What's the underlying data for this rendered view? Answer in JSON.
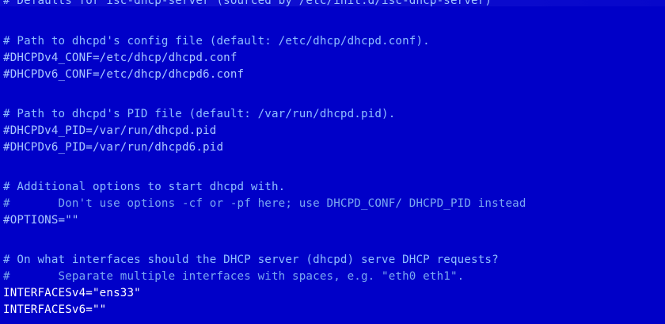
{
  "terminal": {
    "lines": [
      {
        "text": "# Defaults for isc-dhcp-server (sourced by /etc/init.d/isc-dhcp-server)",
        "kind": "comment"
      },
      {
        "text": "# Path to dhcpd's config file (default: /etc/dhcp/dhcpd.conf).",
        "kind": "comment"
      },
      {
        "text": "#DHCPDv4_CONF=/etc/dhcp/dhcpd.conf",
        "kind": "setting"
      },
      {
        "text": "#DHCPDv6_CONF=/etc/dhcp/dhcpd6.conf",
        "kind": "setting"
      },
      {
        "text": "# Path to dhcpd's PID file (default: /var/run/dhcpd.pid).",
        "kind": "comment"
      },
      {
        "text": "#DHCPDv4_PID=/var/run/dhcpd.pid",
        "kind": "setting"
      },
      {
        "text": "#DHCPDv6_PID=/var/run/dhcpd6.pid",
        "kind": "setting"
      },
      {
        "text": "# Additional options to start dhcpd with.",
        "kind": "comment"
      },
      {
        "text": "#       Don't use options -cf or -pf here; use DHCPD_CONF/ DHCPD_PID instead",
        "kind": "comment"
      },
      {
        "text": "#OPTIONS=\"\"",
        "kind": "setting"
      },
      {
        "text": "# On what interfaces should the DHCP server (dhcpd) serve DHCP requests?",
        "kind": "comment"
      },
      {
        "text": "#       Separate multiple interfaces with spaces, e.g. \"eth0 eth1\".",
        "kind": "comment"
      },
      {
        "text": "INTERFACESv4=\"ens33\"",
        "kind": "active"
      },
      {
        "text": "INTERFACESv6=\"\"",
        "kind": "active"
      }
    ]
  }
}
